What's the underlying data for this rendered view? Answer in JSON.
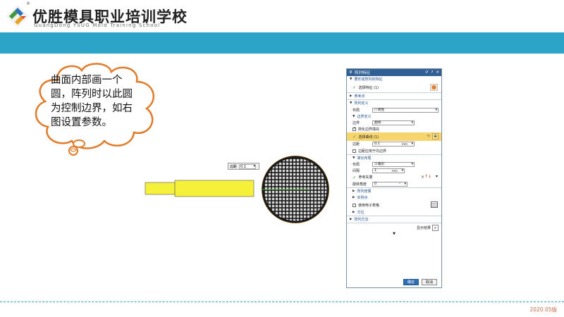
{
  "header": {
    "school_name": "优胜模具职业培训学校",
    "school_name_en": "GuangDong YSUG Mold Training School",
    "reg_mark": "®",
    "banner_color": "#2ba4c7"
  },
  "callout": {
    "text": "曲面内部画一个圆，阵列时以此圆为控制边界，如右图设置参数。"
  },
  "viewport": {
    "distance_label": "边距",
    "distance_value": "0.1"
  },
  "dialog": {
    "title": "阵列特征",
    "title_controls": [
      "↺",
      "?",
      "✕"
    ],
    "sections": {
      "features": "要形成阵列的特征",
      "select_feature": "选择特征 (1)",
      "reference_point": "参考点",
      "array_definition": "阵列定义",
      "layout_label": "布局",
      "layout_value": "线性",
      "boundary_definition": "边界定义",
      "boundary_label": "边界",
      "boundary_value": "曲线",
      "simplified_fill": "简化边界填充",
      "select_curve": "选择曲线 (1)",
      "margin_label": "边距",
      "margin_value": "0.1",
      "margin_unit": "mm",
      "apply_inner": "边距应用于内边界",
      "simplified_layout": "简化布局",
      "layout2_label": "布局",
      "layout2_value": "三角形",
      "spacing_label": "间隔",
      "spacing_value": "1",
      "spacing_unit": "mm",
      "ref_vector": "参考矢量",
      "rotation_label": "旋转角度",
      "rotation_value": "0",
      "rotation_unit": "°",
      "array_increment": "阵列增量",
      "instance_points": "实例点",
      "use_spreadsheet": "使用电子表格",
      "orientation": "方位",
      "array_method": "阵列方法",
      "show_result": "显示结果"
    },
    "ok_label": "确定",
    "cancel_label": "取消"
  },
  "footer": {
    "edition": "2020.05版"
  }
}
